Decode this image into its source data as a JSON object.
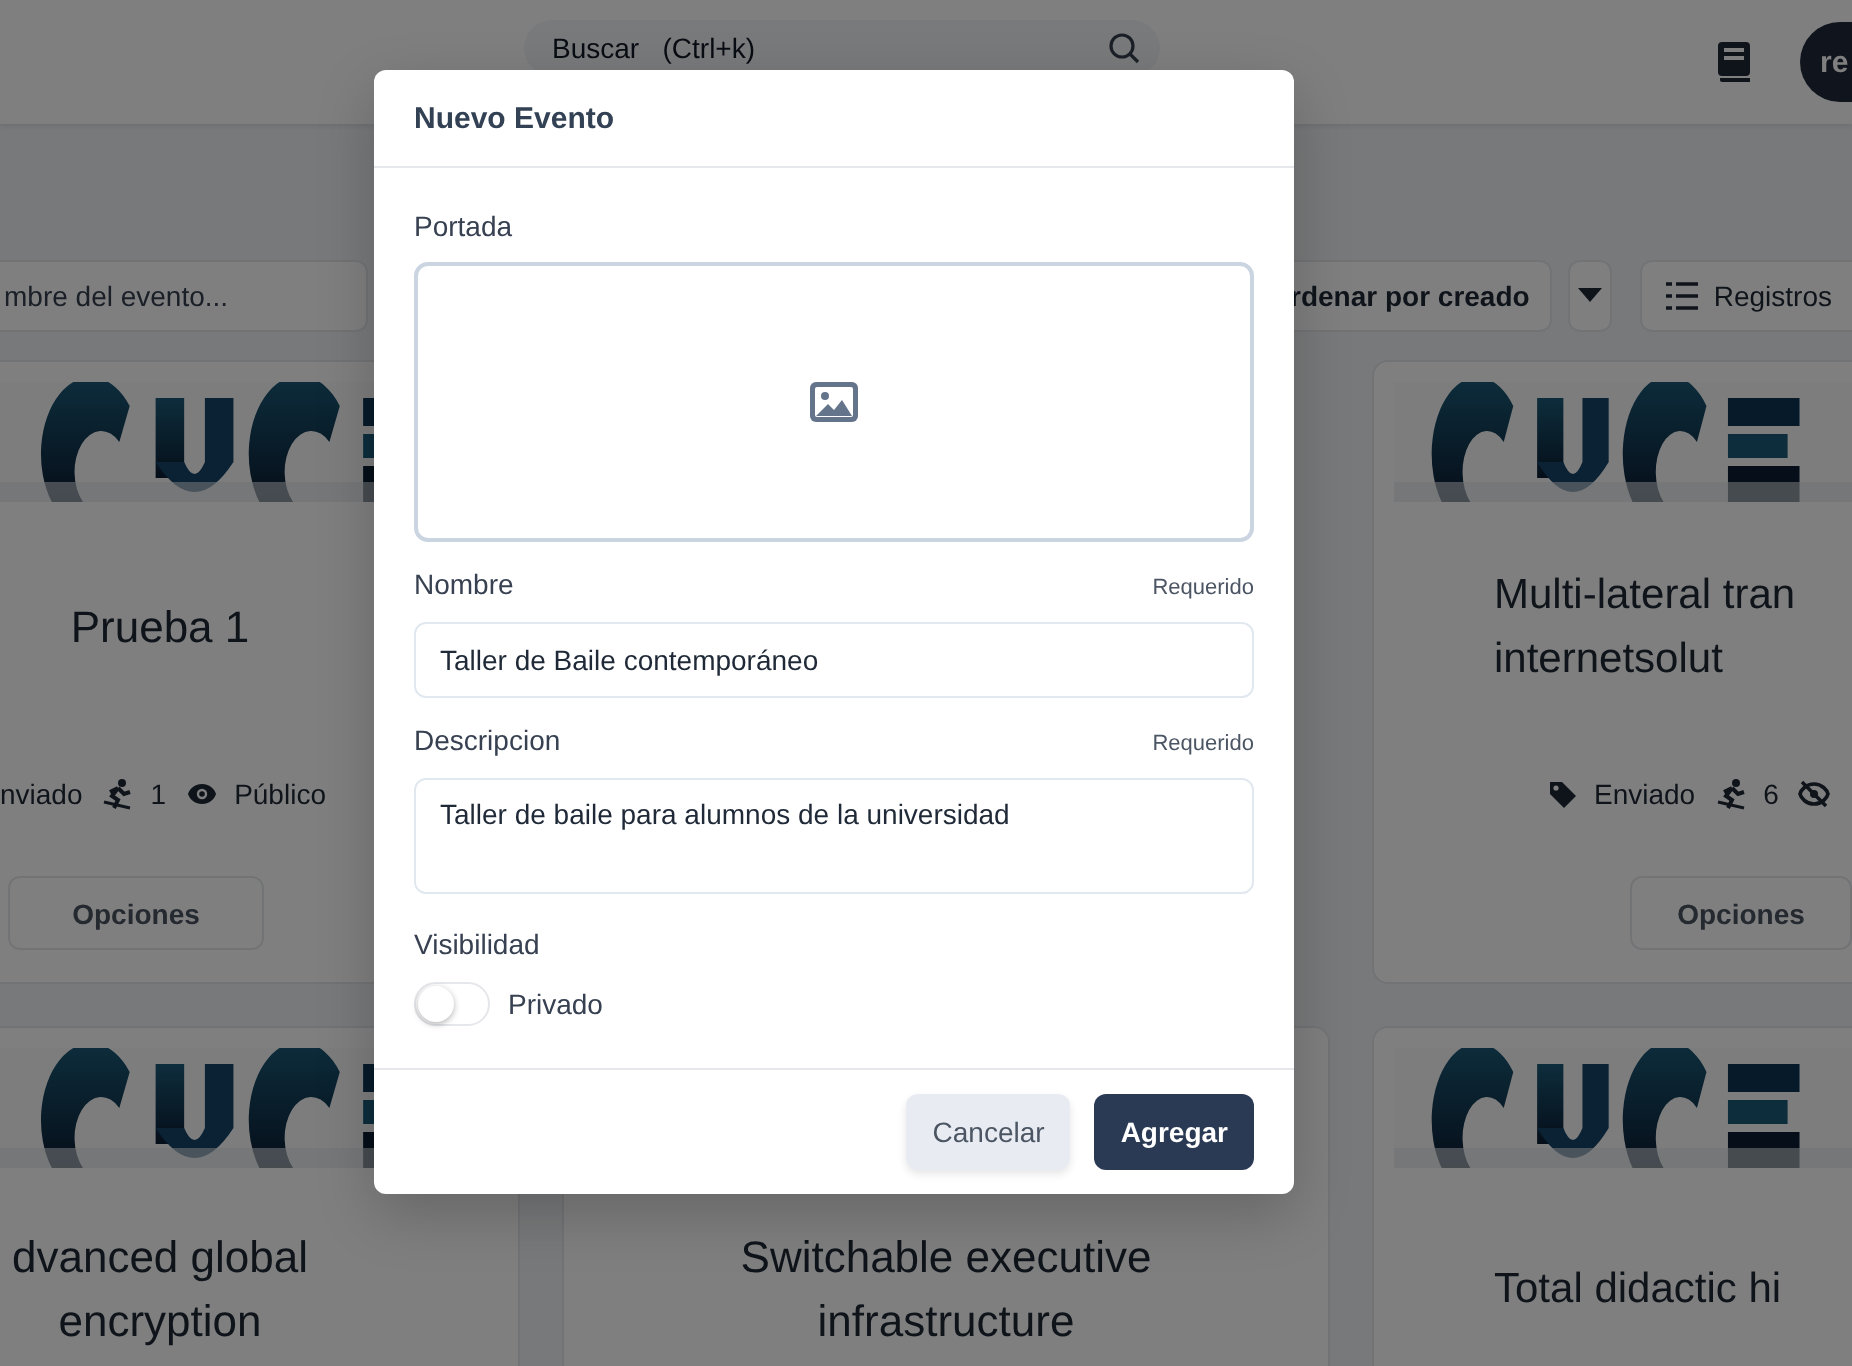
{
  "header": {
    "search": {
      "placeholder": "Buscar   (Ctrl+k)"
    },
    "avatar": "re"
  },
  "toolbar": {
    "name_filter": {
      "placeholder": "mbre del evento..."
    },
    "sort_button": "rdenar por creado",
    "view_button": "Registros"
  },
  "cards": [
    {
      "title": "Prueba 1",
      "meta": [
        {
          "kind": "text",
          "text": "nviado"
        },
        {
          "kind": "participants",
          "text": "1"
        },
        {
          "kind": "public",
          "text": "Público"
        }
      ],
      "button": "Opciones"
    },
    {
      "title": "Multi-lateral tran\ninternetsolut",
      "meta": [
        {
          "kind": "status",
          "text": "Enviado"
        },
        {
          "kind": "participants",
          "text": "6"
        },
        {
          "kind": "private"
        }
      ],
      "button": "Opciones"
    },
    {
      "title": "dvanced global\nencryption"
    },
    {
      "title": "Switchable executive\ninfrastructure"
    },
    {
      "title": "Total didactic hi"
    }
  ],
  "modal": {
    "title": "Nuevo Evento",
    "cover": {
      "label": "Portada"
    },
    "fields": [
      {
        "kind": "input",
        "label": "Nombre",
        "hint": "Requerido",
        "value": "Taller de Baile contemporáneo"
      },
      {
        "kind": "textarea",
        "label": "Descripcion",
        "hint": "Requerido",
        "value": "Taller de baile para alumnos de la universidad"
      }
    ],
    "visibility": {
      "label": "Visibilidad",
      "toggle_label": "Privado",
      "on": false
    },
    "buttons": [
      {
        "kind": "secondary",
        "label": "Cancelar"
      },
      {
        "kind": "primary",
        "label": "Agregar"
      }
    ]
  }
}
